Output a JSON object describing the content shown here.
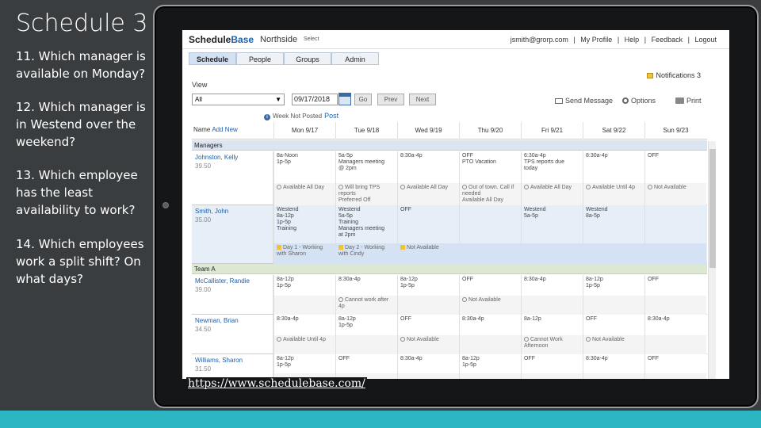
{
  "slide": {
    "title": "Schedule 3",
    "questions": [
      "11.  Which manager is available on Monday?",
      "12. Which manager is in Westend over the weekend?",
      "13. Which employee has the least availability to work?",
      "14. Which employees work a split shift? On what days?"
    ]
  },
  "app": {
    "logo_main": "Schedule",
    "logo_accent": "Base",
    "org": "Northside",
    "select_label": "Select",
    "user_email": "jsmith@grorp.com",
    "top_links": [
      "|",
      "My Profile",
      "|",
      "Help",
      "|",
      "Feedback",
      "|",
      "Logout"
    ],
    "tabs": [
      "Schedule",
      "People",
      "Groups",
      "Admin"
    ],
    "notifications": "Notifications 3",
    "view_label": "View",
    "view_value": "All",
    "date_value": "09/17/2018",
    "go_label": "Go",
    "prev_label": "Prev",
    "next_label": "Next",
    "send_message": "Send Message",
    "options": "Options",
    "print": "Print",
    "status": "Week Not Posted",
    "post": "Post",
    "name_label": "Name",
    "add_new": "Add New",
    "days": [
      "Mon 9/17",
      "Tue 9/18",
      "Wed 9/19",
      "Thu 9/20",
      "Fri 9/21",
      "Sat 9/22",
      "Sun 9/23"
    ],
    "groups": {
      "managers": "Managers",
      "team_a": "Team A"
    },
    "employees": [
      {
        "name": "Johnston, Kelly",
        "hours": "39.50",
        "shifts": [
          "8a-Noon\n1p-5p",
          "5a-5p\nManagers meeting\n@ 2pm",
          "8:30a-4p",
          "OFF\nPTO Vacation",
          "6:30a-4p\nTPS reports due\ntoday",
          "8:30a-4p",
          "OFF"
        ],
        "avail": [
          "Available All Day",
          "Will bring TPS reports\nPreferred Off",
          "Available All Day",
          "Out of town. Call if needed\nAvailable All Day",
          "Available All Day",
          "Available Until 4p",
          "Not Available"
        ]
      },
      {
        "name": "Smith, John",
        "hours": "35.00",
        "shifts": [
          "Westend\n8a-12p\n1p-5p\nTraining",
          "Westend\n5a-5p\nTraining\nManagers meeting\nat 2pm",
          "OFF",
          "",
          "Westend\n5a-5p",
          "Westend\n8a-5p",
          ""
        ],
        "avail": [
          "Day 1 - Working with Sharon",
          "Day 2 - Working with Cindy",
          "Not Available",
          "",
          "",
          "",
          ""
        ]
      },
      {
        "name": "McCallister, Randie",
        "hours": "39.00",
        "shifts": [
          "8a-12p\n1p-5p",
          "8:30a-4p",
          "8a-12p\n1p-5p",
          "OFF",
          "8:30a-4p",
          "8a-12p\n1p-5p",
          "OFF"
        ],
        "avail": [
          "",
          "Cannot work after 4p",
          "",
          "Not Available",
          "",
          "",
          ""
        ]
      },
      {
        "name": "Newman, Brian",
        "hours": "34.50",
        "shifts": [
          "8:30a-4p",
          "8a-12p\n1p-5p",
          "OFF",
          "8:30a-4p",
          "8a-12p",
          "OFF",
          "8:30a-4p"
        ],
        "avail": [
          "Available Until 4p",
          "",
          "Not Available",
          "",
          "Cannot Work Afternoon",
          "Not Available",
          ""
        ]
      },
      {
        "name": "Williams, Sharon",
        "hours": "31.50",
        "shifts": [
          "8a-12p\n1p-5p",
          "OFF",
          "8:30a-4p",
          "8a-12p\n1p-5p",
          "OFF",
          "8:30a-4p",
          "OFF"
        ],
        "avail": [
          "",
          "",
          "",
          "",
          "",
          "",
          ""
        ]
      }
    ]
  },
  "url": "https://www.schedulebase.com/"
}
